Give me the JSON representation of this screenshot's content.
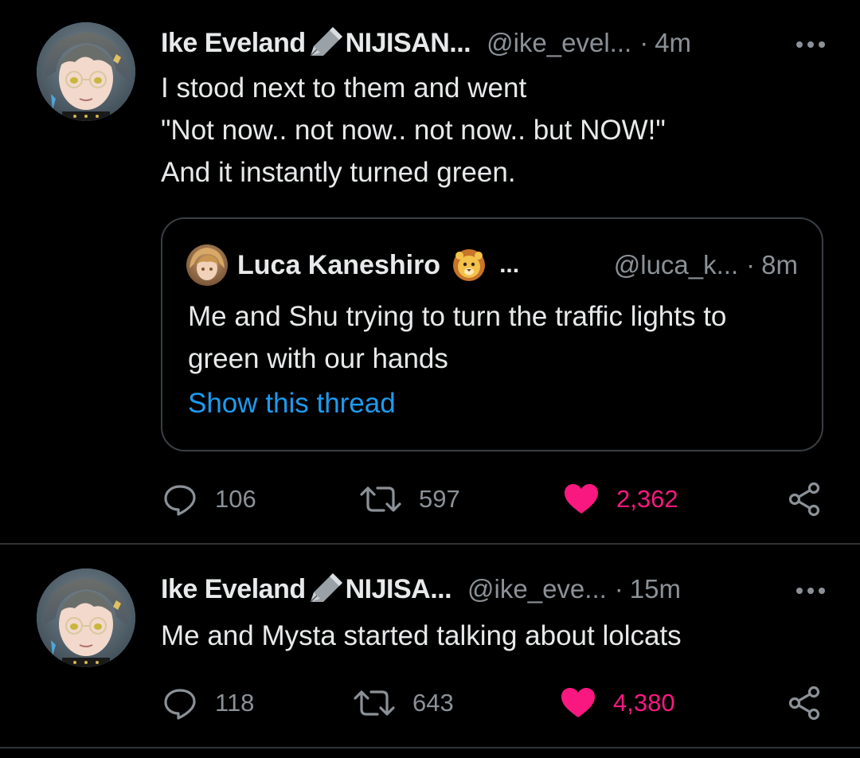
{
  "tweets": [
    {
      "author_name": "Ike Eveland",
      "author_suffix": "NIJISAN...",
      "handle": "@ike_evel...",
      "separator": "·",
      "time": "4m",
      "text_lines": [
        "I stood next to them and went",
        "\"Not now.. not now.. not now.. but NOW!\"",
        "And it instantly turned green."
      ],
      "quote": {
        "author_name": "Luca Kaneshiro",
        "author_emoji": "lion-face-icon",
        "ellipsis": "...",
        "handle": "@luca_k...",
        "separator": "·",
        "time": "8m",
        "text_lines": [
          "Me and Shu trying to turn the traffic lights to",
          "green with our hands"
        ],
        "show_thread": "Show this thread"
      },
      "replies": "106",
      "retweets": "597",
      "likes": "2,362",
      "liked": true
    },
    {
      "author_name": "Ike Eveland",
      "author_suffix": "NIJISA...",
      "handle": "@ike_eve...",
      "separator": "·",
      "time": "15m",
      "text_lines": [
        "Me and Mysta started talking about lolcats"
      ],
      "replies": "118",
      "retweets": "643",
      "likes": "4,380",
      "liked": true
    }
  ],
  "icons": {
    "reply": "reply-icon",
    "retweet": "retweet-icon",
    "like": "heart-icon",
    "share": "share-icon",
    "more": "more-options-icon",
    "name_emoji": "fountain-pen-icon"
  },
  "colors": {
    "background": "#000000",
    "text": "#e7e9ea",
    "secondary_text": "#8b9197",
    "link": "#1d9bf0",
    "like": "#f91880",
    "border": "#2f3336"
  }
}
